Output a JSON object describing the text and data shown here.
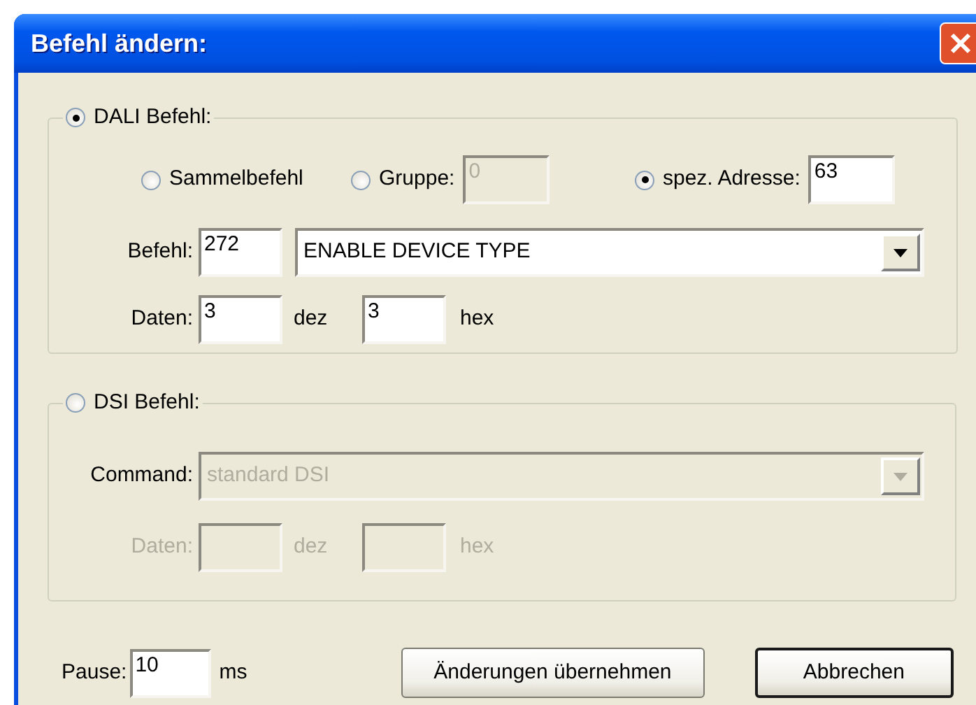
{
  "window": {
    "title": "Befehl ändern:"
  },
  "dali": {
    "label": "DALI Befehl:",
    "selected": true,
    "disabled": false,
    "targets": [
      {
        "kind": "radio",
        "label": "Sammelbefehl",
        "selected": false
      },
      {
        "kind": "radio_field",
        "label": "Gruppe:",
        "selected": false,
        "value": "0",
        "disabled": true
      },
      {
        "kind": "radio_field",
        "label": "spez. Adresse:",
        "selected": true,
        "value": "63",
        "disabled": false
      }
    ],
    "command": {
      "label": "Befehl:",
      "number": "272",
      "value": "ENABLE DEVICE TYPE"
    },
    "data": {
      "label": "Daten:",
      "dec": "3",
      "dec_unit": "dez",
      "hex": "3",
      "hex_unit": "hex"
    }
  },
  "dsi": {
    "label": "DSI Befehl:",
    "selected": false,
    "disabled": true,
    "command": {
      "label": "Command:",
      "value": "standard DSI"
    },
    "data": {
      "label": "Daten:",
      "dec_unit": "dez",
      "hex_unit": "hex"
    }
  },
  "pause": {
    "label": "Pause:",
    "value": "10",
    "unit": "ms"
  },
  "buttons": [
    {
      "label": "Änderungen übernehmen",
      "default": false
    },
    {
      "label": "Abbrechen",
      "default": true
    }
  ]
}
